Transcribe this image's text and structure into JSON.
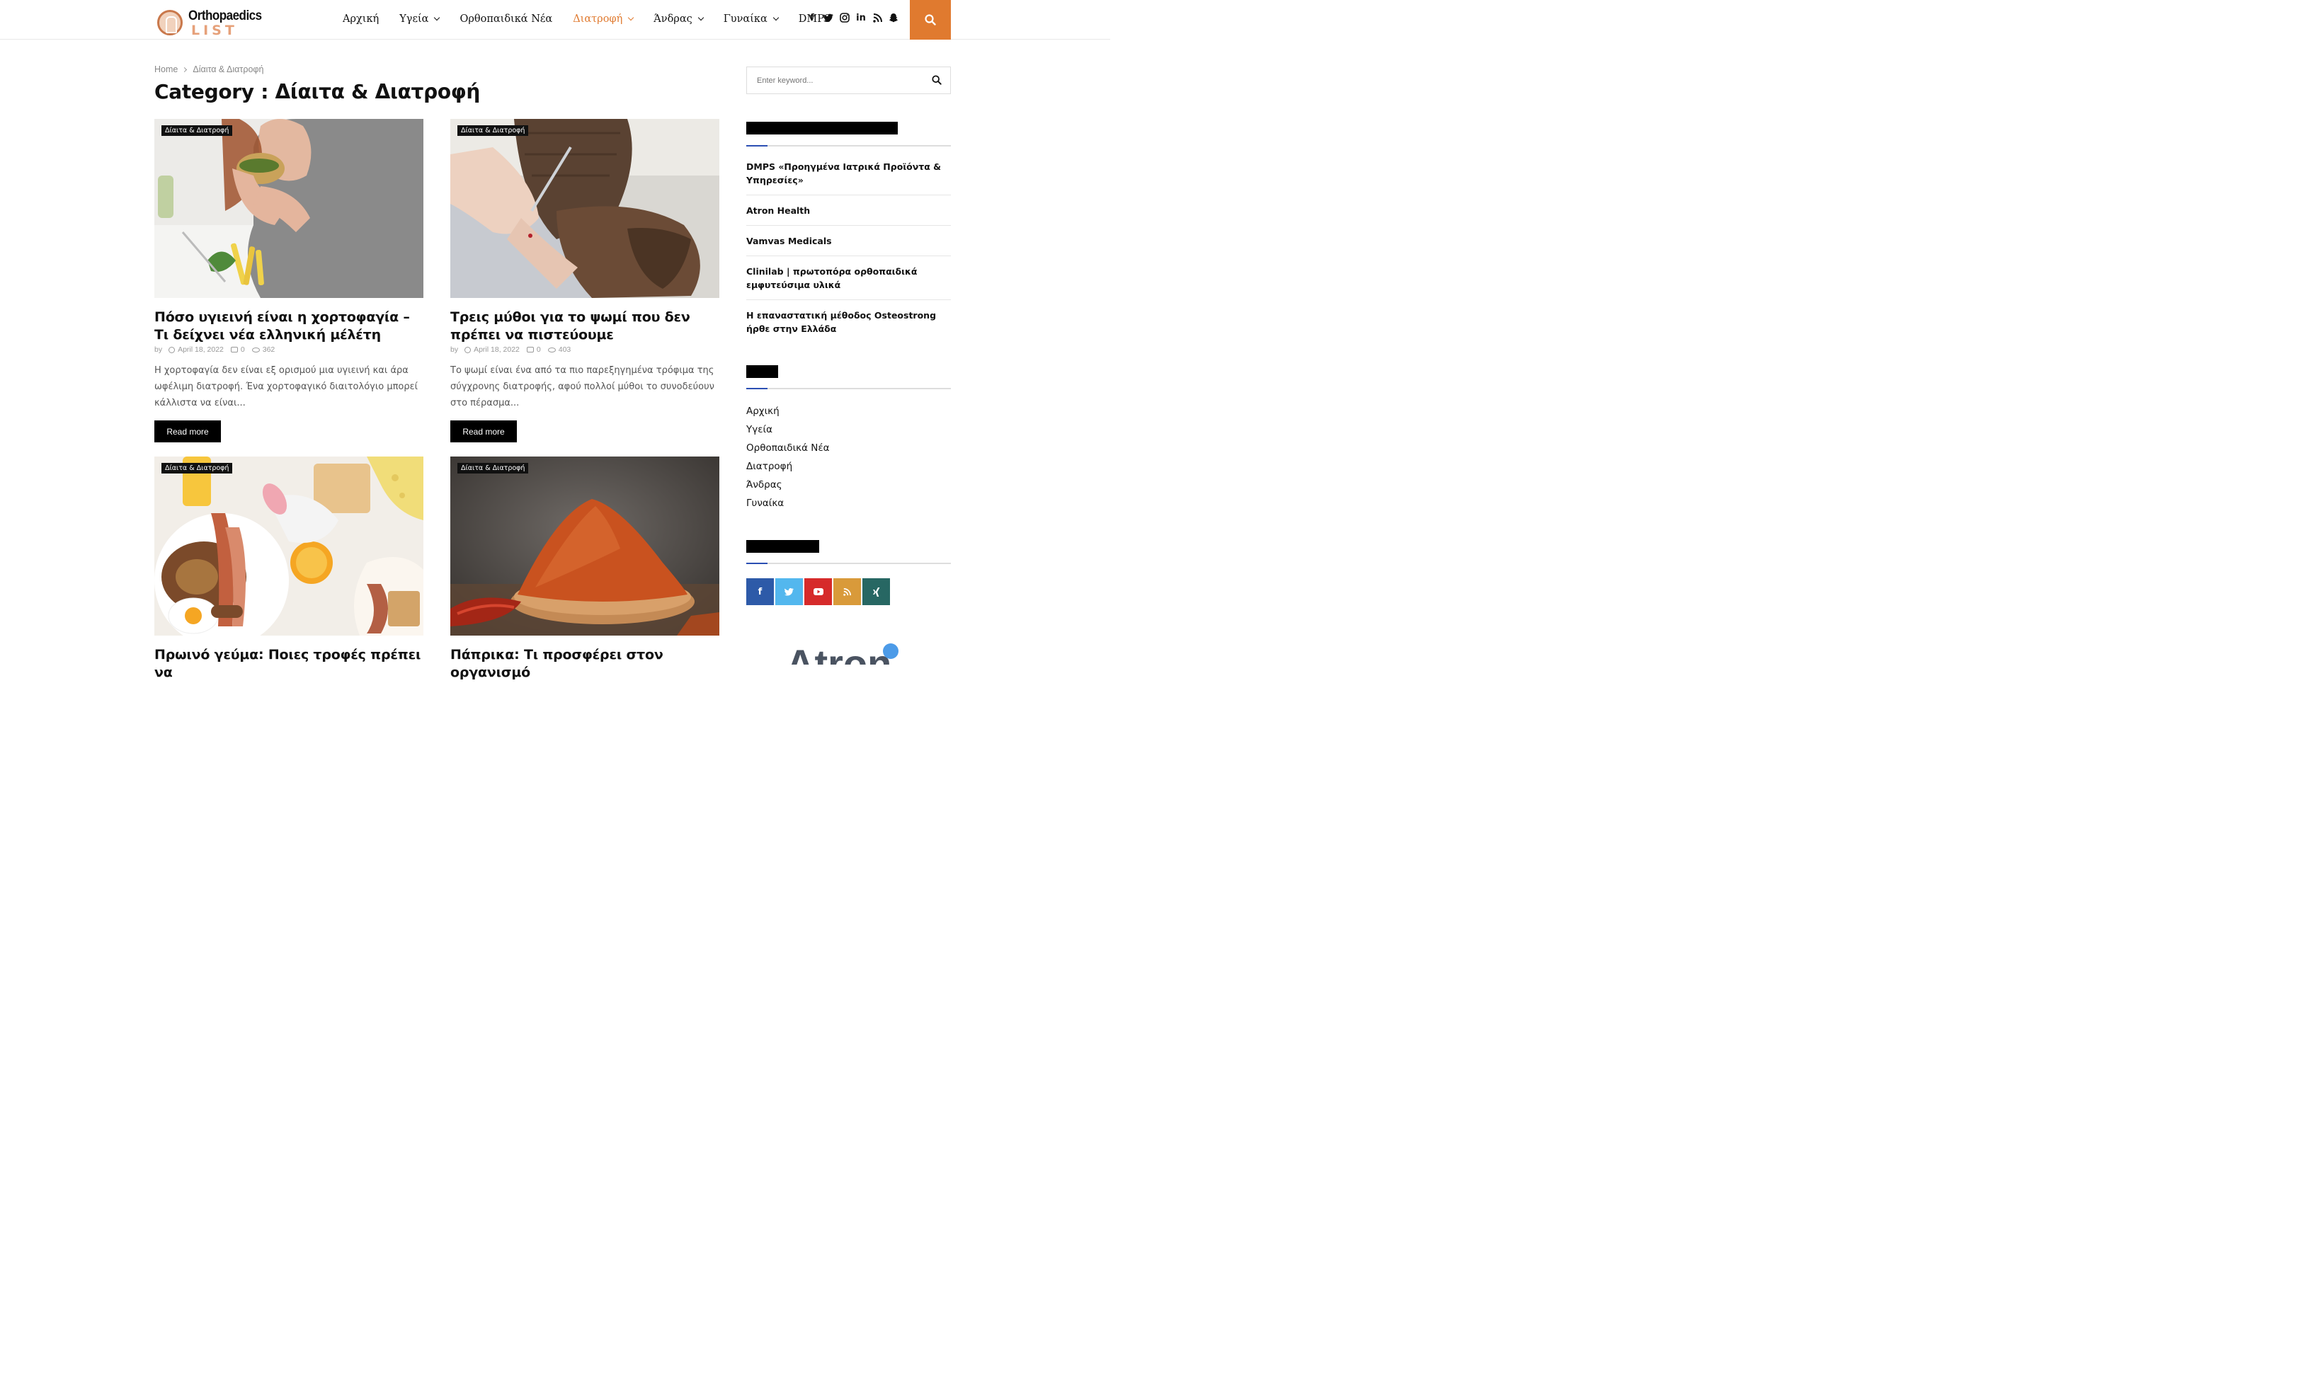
{
  "header": {
    "logo_top": "Orthopaedics",
    "logo_bottom": "LIST",
    "nav": [
      {
        "label": "Αρχική",
        "dropdown": false,
        "active": false
      },
      {
        "label": "Υγεία",
        "dropdown": true,
        "active": false
      },
      {
        "label": "Ορθοπαιδικά Νέα",
        "dropdown": false,
        "active": false
      },
      {
        "label": "Διατροφή",
        "dropdown": true,
        "active": true
      },
      {
        "label": "Άνδρας",
        "dropdown": true,
        "active": false
      },
      {
        "label": "Γυναίκα",
        "dropdown": true,
        "active": false
      },
      {
        "label": "DMPS",
        "dropdown": false,
        "active": false
      }
    ],
    "social_icons": [
      "facebook-icon",
      "twitter-icon",
      "instagram-icon",
      "linkedin-icon",
      "rss-icon",
      "snapchat-icon"
    ],
    "accent_color": "#e07a2f"
  },
  "breadcrumb": {
    "home": "Home",
    "current": "Δίαιτα & Διατροφή"
  },
  "page_title": "Category : Δίαιτα & Διατροφή",
  "articles": [
    {
      "category": "Δίαιτα & Διατροφή",
      "title": "Πόσο υγιεινή είναι η χορτοφαγία – Τι δείχνει νέα ελληνική μέλέτη",
      "by": "by",
      "date": "April 18, 2022",
      "comments": "0",
      "views": "362",
      "excerpt": "Η χορτοφαγία δεν είναι εξ ορισμού μια υγιεινή και άρα ωφέλιμη διατροφή. Ένα χορτοφαγικό διαιτολόγιο μπορεί κάλλιστα να είναι...",
      "read_more": "Read more",
      "image": "woman-eating-burger"
    },
    {
      "category": "Δίαιτα & Διατροφή",
      "title": "Τρεις μύθοι για το ψωμί που δεν πρέπει να πιστεύουμε",
      "by": "by",
      "date": "April 18, 2022",
      "comments": "0",
      "views": "403",
      "excerpt": "Το ψωμί είναι ένα από τα πιο παρεξηγημένα τρόφιμα της σύγχρονης διατροφής, αφού πολλοί μύθοι το συνοδεύουν στο πέρασμα...",
      "read_more": "Read more",
      "image": "cutting-rye-bread"
    },
    {
      "category": "Δίαιτα & Διατροφή",
      "title": "Πρωινό γεύμα: Ποιες τροφές πρέπει να",
      "image": "breakfast-table"
    },
    {
      "category": "Δίαιτα & Διατροφή",
      "title": "Πάπρικα: Τι προσφέρει στον οργανισμό",
      "image": "paprika-bowl"
    }
  ],
  "sidebar": {
    "search_placeholder": "Enter keyword...",
    "popular": [
      "DMPS «Προηγμένα Ιατρικά Προϊόντα & Υπηρεσίες»",
      "Atron Health",
      "Vamvas Medicals",
      "Clinilab | πρωτοπόρα ορθοπαιδικά εμφυτεύσιμα υλικά",
      "Η επαναστατική μέθοδος Osteostrong ήρθε στην Ελλάδα"
    ],
    "categories": [
      "Αρχική",
      "Υγεία",
      "Ορθοπαιδικά Νέα",
      "Διατροφή",
      "Άνδρας",
      "Γυναίκα"
    ],
    "follow": [
      {
        "icon": "facebook-icon",
        "glyph": "f",
        "color": "#2d5aa8"
      },
      {
        "icon": "twitter-icon",
        "glyph": "t",
        "color": "#53b7ee"
      },
      {
        "icon": "youtube-icon",
        "glyph": "▶",
        "color": "#d62a2a"
      },
      {
        "icon": "rss-icon",
        "glyph": "◎",
        "color": "#d99a3a"
      },
      {
        "icon": "xing-icon",
        "glyph": "✕",
        "color": "#276763"
      }
    ],
    "ad_peek": "Atron"
  }
}
